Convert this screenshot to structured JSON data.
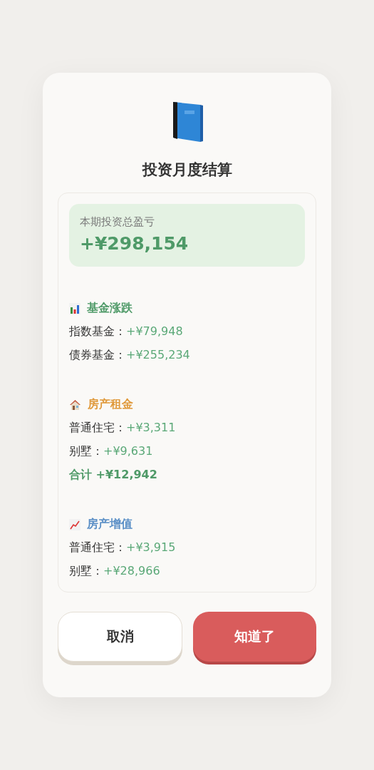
{
  "dialog": {
    "title": "投资月度结算"
  },
  "summary": {
    "label": "本期投资总盈亏",
    "value": "+¥298,154"
  },
  "sections": [
    {
      "kind": "chart",
      "title": "基金涨跌",
      "color": "#4f9a68",
      "lines": [
        {
          "label": "指数基金：",
          "value": "+¥79,948"
        },
        {
          "label": "债券基金：",
          "value": "+¥255,234"
        }
      ]
    },
    {
      "kind": "house",
      "title": "房产租金",
      "color": "#e09a3c",
      "lines": [
        {
          "label": "普通住宅：",
          "value": "+¥3,311"
        },
        {
          "label": "别墅：",
          "value": "+¥9,631"
        }
      ],
      "total": "合计 +¥12,942"
    },
    {
      "kind": "trend",
      "title": "房产增值",
      "color": "#5a8fc6",
      "lines": [
        {
          "label": "普通住宅：",
          "value": "+¥3,915"
        },
        {
          "label": "别墅：",
          "value": "+¥28,966"
        }
      ]
    }
  ],
  "buttons": [
    {
      "kind": "secondary",
      "label": "取消"
    },
    {
      "kind": "primary",
      "label": "知道了"
    }
  ]
}
